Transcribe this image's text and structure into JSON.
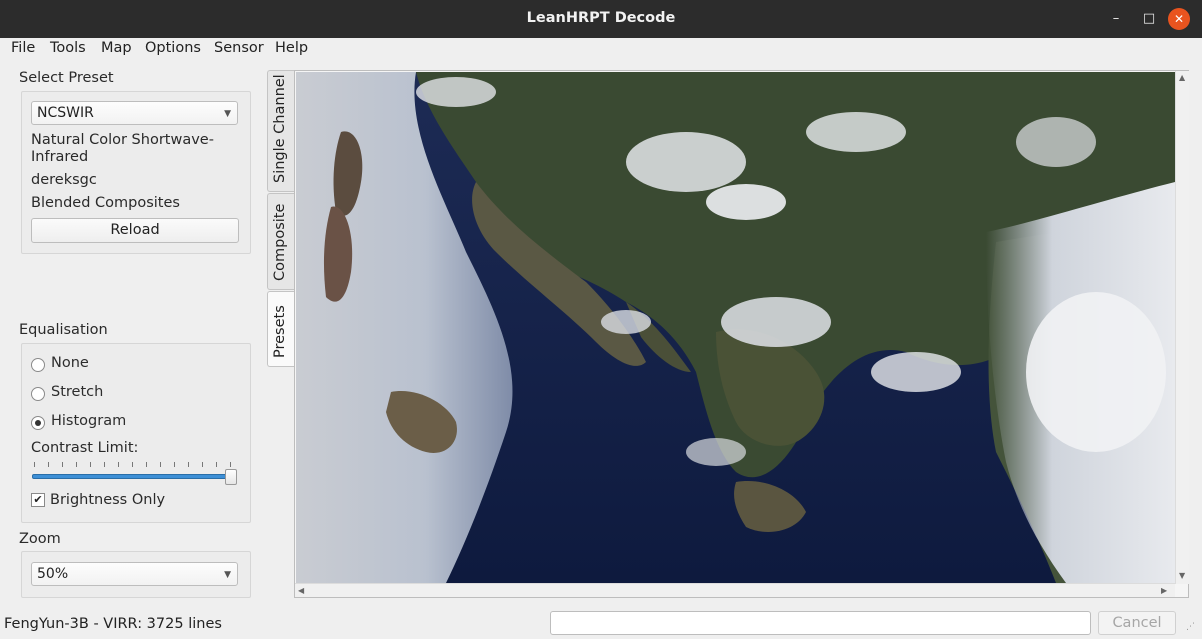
{
  "window": {
    "title": "LeanHRPT Decode",
    "controls": {
      "minimize": "–",
      "maximize": "□",
      "close": "✕"
    }
  },
  "menubar": {
    "items": [
      "File",
      "Tools",
      "Map",
      "Options",
      "Sensor",
      "Help"
    ]
  },
  "preset": {
    "section_label": "Select Preset",
    "selected": "NCSWIR",
    "name_line1": "Natural Color Shortwave-",
    "name_line2": "Infrared",
    "author": "dereksgc",
    "category": "Blended Composites",
    "reload_label": "Reload"
  },
  "equalisation": {
    "section_label": "Equalisation",
    "options": [
      "None",
      "Stretch",
      "Histogram"
    ],
    "selected": "Histogram",
    "contrast_label": "Contrast Limit:",
    "contrast_value": 1.0,
    "brightness_only_label": "Brightness Only",
    "brightness_only_checked": true
  },
  "zoom": {
    "section_label": "Zoom",
    "selected": "50%"
  },
  "tabs": [
    "Single Channel",
    "Composite",
    "Presets"
  ],
  "active_tab": "Presets",
  "status": {
    "text": "FengYun-3B - VIRR: 3725 lines",
    "progress_value": "",
    "cancel_label": "Cancel"
  },
  "icons": {
    "combo_arrow": "chevron-down-icon",
    "scroll_up": "arrow-up-icon",
    "scroll_down": "arrow-down-icon",
    "scroll_left": "arrow-left-icon",
    "scroll_right": "arrow-right-icon",
    "check": "checkmark-icon"
  },
  "colors": {
    "slider_accent": "#3d8fd6",
    "close_button": "#e9541f",
    "titlebar": "#2c2c2c"
  }
}
